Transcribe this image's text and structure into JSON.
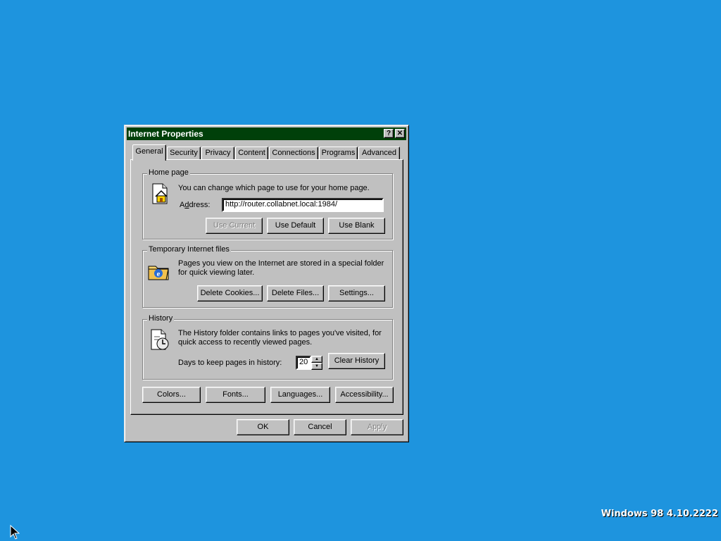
{
  "dialog": {
    "title": "Internet Properties",
    "help_glyph": "?",
    "close_glyph": "✕",
    "tabs": [
      "General",
      "Security",
      "Privacy",
      "Content",
      "Connections",
      "Programs",
      "Advanced"
    ],
    "active_tab": "General"
  },
  "home_page": {
    "group_label": "Home page",
    "description": "You can change which page to use for your home page.",
    "address_label": "Address:",
    "address_value": "http://router.collabnet.local:1984/",
    "use_current": "Use Current",
    "use_default": "Use Default",
    "use_blank": "Use Blank",
    "icon": "home-page-icon"
  },
  "temp_files": {
    "group_label": "Temporary Internet files",
    "description_line1": "Pages you view on the Internet are stored in a special folder",
    "description_line2": "for quick viewing later.",
    "delete_cookies": "Delete Cookies...",
    "delete_files": "Delete Files...",
    "settings": "Settings...",
    "icon": "temp-folder-ie-icon"
  },
  "history": {
    "group_label": "History",
    "description_line1": "The History folder contains links to pages you've visited, for",
    "description_line2": "quick access to recently viewed pages.",
    "days_label": "Days to keep pages in history:",
    "days_value": "20",
    "clear_history": "Clear History",
    "icon": "history-clock-icon"
  },
  "bottom_buttons": {
    "colors": "Colors...",
    "fonts": "Fonts...",
    "languages": "Languages...",
    "accessibility": "Accessibility..."
  },
  "footer": {
    "ok": "OK",
    "cancel": "Cancel",
    "apply": "Apply"
  },
  "desktop": {
    "os_version": "Windows 98 4.10.2222",
    "background_color": "#1e94de"
  }
}
